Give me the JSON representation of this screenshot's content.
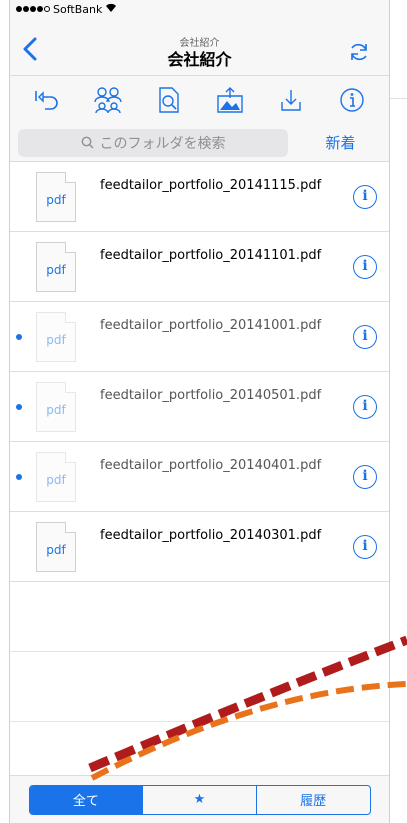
{
  "status_bar": {
    "carrier": "SoftBank",
    "signal_filled": 4,
    "signal_total": 5
  },
  "nav": {
    "subtitle": "会社紹介",
    "title": "会社紹介"
  },
  "toolbar": {
    "icons": [
      "undo-icon",
      "people-icon",
      "document-search-icon",
      "image-upload-icon",
      "download-icon",
      "info-icon"
    ]
  },
  "search": {
    "placeholder": "このフォルダを検索",
    "new_label": "新着"
  },
  "files": [
    {
      "name": "feedtailor_portfolio_20141115.pdf",
      "thumb_label": "pdf",
      "unread": false,
      "faded": false
    },
    {
      "name": "feedtailor_portfolio_20141101.pdf",
      "thumb_label": "pdf",
      "unread": false,
      "faded": false
    },
    {
      "name": "feedtailor_portfolio_20141001.pdf",
      "thumb_label": "pdf",
      "unread": true,
      "faded": true
    },
    {
      "name": "feedtailor_portfolio_20140501.pdf",
      "thumb_label": "pdf",
      "unread": true,
      "faded": true
    },
    {
      "name": "feedtailor_portfolio_20140401.pdf",
      "thumb_label": "pdf",
      "unread": true,
      "faded": true
    },
    {
      "name": "feedtailor_portfolio_20140301.pdf",
      "thumb_label": "pdf",
      "unread": false,
      "faded": false
    }
  ],
  "segments": [
    {
      "label": "全て",
      "active": true
    },
    {
      "label": "★",
      "active": false
    },
    {
      "label": "履歴",
      "active": false
    }
  ],
  "colors": {
    "accent": "#1a73e8",
    "annotation_red": "#b01c1c",
    "annotation_orange": "#e8731a"
  }
}
